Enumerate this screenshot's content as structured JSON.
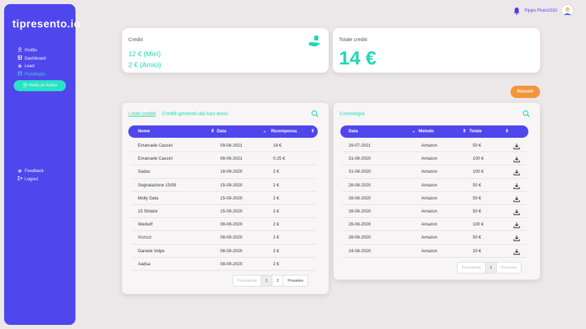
{
  "app": {
    "logo": "tipresento.io"
  },
  "sidebar": {
    "items": [
      {
        "label": "Profilo",
        "icon": "user-icon",
        "active": false
      },
      {
        "label": "Dashboard",
        "icon": "dashboard-icon",
        "active": false
      },
      {
        "label": "Lead",
        "icon": "asterisk-icon",
        "active": false
      },
      {
        "label": "Portafoglio",
        "icon": "wallet-icon",
        "active": true
      }
    ],
    "invite_label": "Invita un Amico",
    "bottom_items": [
      {
        "label": "Feedback",
        "icon": "asterisk-icon"
      },
      {
        "label": "Logout",
        "icon": "logout-icon"
      }
    ]
  },
  "topbar": {
    "username": "Pippo Pluto2332"
  },
  "credit_card": {
    "title": "Crediti",
    "mine": "12 € (Miei)",
    "friends": "2 € (Amici)"
  },
  "total_card": {
    "title": "Totale crediti",
    "value": "14 €"
  },
  "riscuoti_label": "Riscuoti",
  "credits_table": {
    "tab_mine": "I miei crediti",
    "tab_friends": "Crediti generati dai tuoi amici",
    "headers": [
      "Nome",
      "Data",
      "Ricompensa"
    ],
    "rows": [
      [
        "Emanuele Cassini",
        "09-06-2021",
        "18 €"
      ],
      [
        "Emanuele Cassini",
        "08-06-2021",
        "0.25 €"
      ],
      [
        "Sadas",
        "18-09-2020",
        "2 €"
      ],
      [
        "Segnalazione 15/09",
        "15-09-2020",
        "2 €"
      ],
      [
        "Molly Data",
        "15-09-2020",
        "2 €"
      ],
      [
        "15 Shtator",
        "15-09-2020",
        "2 €"
      ],
      [
        "Wedsdf",
        "08-09-2020",
        "2 €"
      ],
      [
        "Xczccz",
        "08-09-2020",
        "2 €"
      ],
      [
        "Daniele Volpe",
        "08-09-2020",
        "2 €"
      ],
      [
        "Aadsa",
        "08-09-2020",
        "2 €"
      ]
    ],
    "pager": {
      "prev": "Precedente",
      "pages": [
        "1",
        "2"
      ],
      "next": "Prossimo"
    }
  },
  "history_table": {
    "title": "Cronologia",
    "headers": [
      "Data",
      "Metodo",
      "Totale"
    ],
    "rows": [
      [
        "29-07-2021",
        "Amazon",
        "50 €"
      ],
      [
        "31-08-2020",
        "Amazon",
        "100 €"
      ],
      [
        "31-08-2020",
        "Amazon",
        "100 €"
      ],
      [
        "28-08-2020",
        "Amazon",
        "50 €"
      ],
      [
        "28-08-2020",
        "Amazon",
        "50 €"
      ],
      [
        "28-08-2020",
        "Amazon",
        "50 €"
      ],
      [
        "28-08-2020",
        "Amazon",
        "100 €"
      ],
      [
        "28-08-2020",
        "Amazon",
        "50 €"
      ],
      [
        "24-08-2020",
        "Amazon",
        "20 €"
      ]
    ],
    "pager": {
      "prev": "Precedente",
      "pages": [
        "1"
      ],
      "next": "Prossimo"
    }
  },
  "colors": {
    "primary": "#5046ee",
    "accent": "#1fd9b5",
    "orange": "#f5953b"
  }
}
